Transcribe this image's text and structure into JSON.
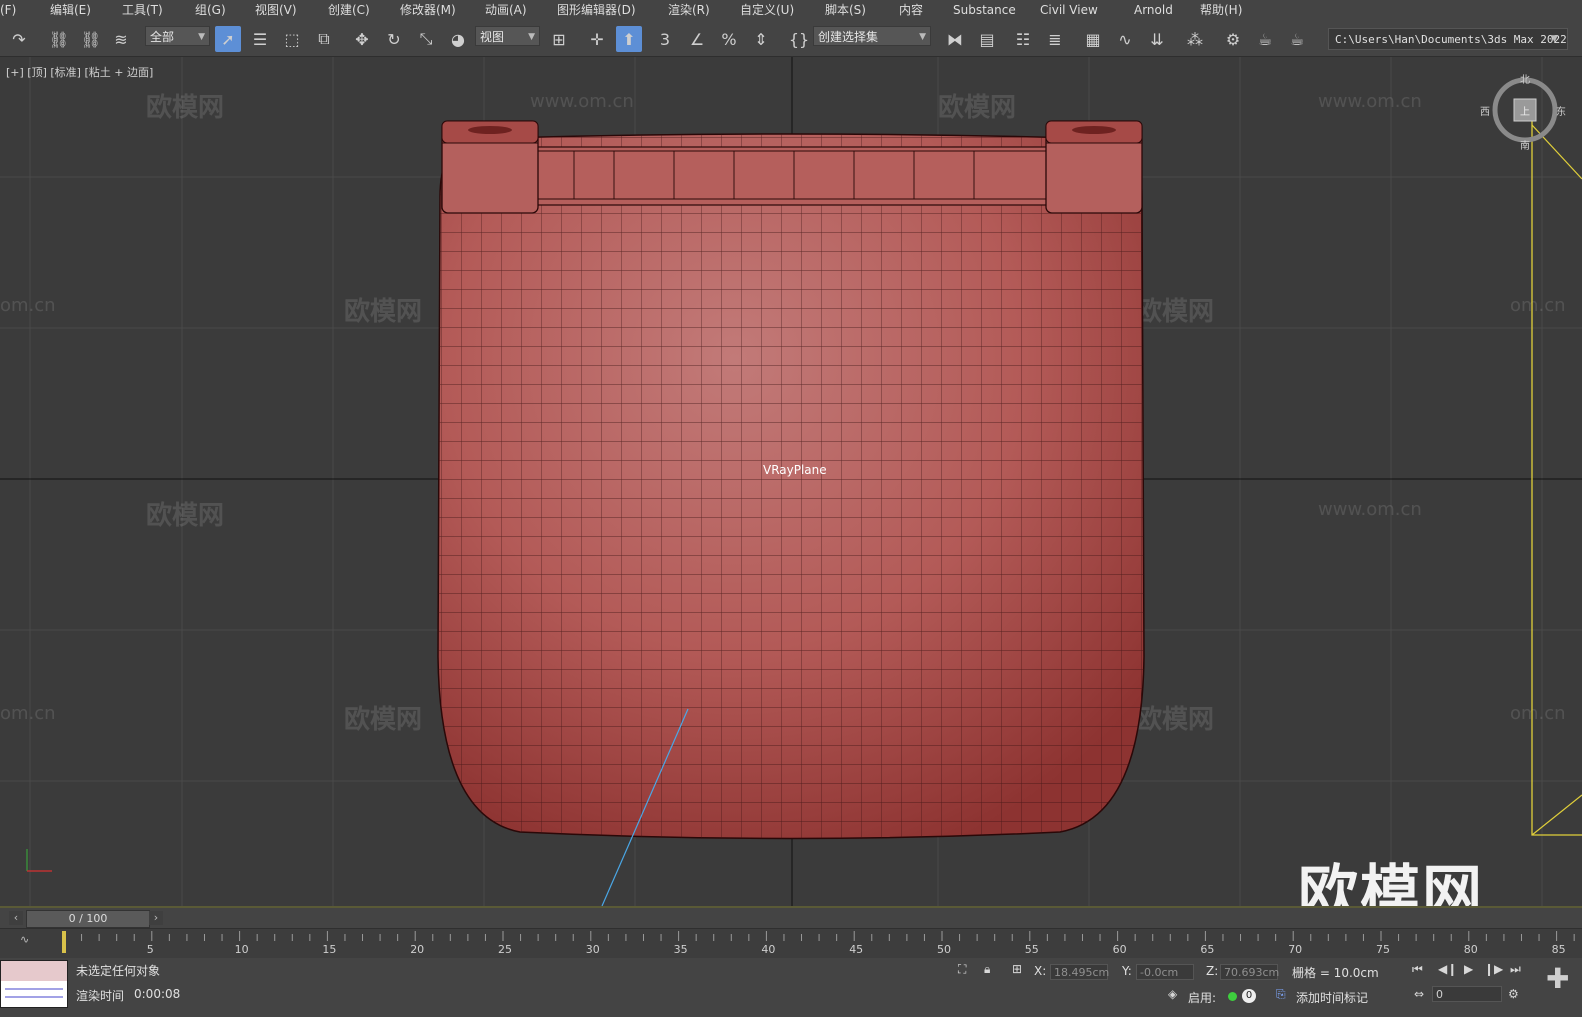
{
  "menu": [
    "(F)",
    "编辑(E)",
    "工具(T)",
    "组(G)",
    "视图(V)",
    "创建(C)",
    "修改器(M)",
    "动画(A)",
    "图形编辑器(D)",
    "渲染(R)",
    "自定义(U)",
    "脚本(S)",
    "内容",
    "Substance",
    "Civil View",
    "Arnold",
    "帮助(H)"
  ],
  "toolbar": {
    "selection_filter": "全部",
    "ref_coord": "视图",
    "named_selection": "创建选择集",
    "project_path": "C:\\Users\\Han\\Documents\\3ds Max 2022"
  },
  "viewport": {
    "label": "[+] [顶] [标准] [粘土 + 边面]",
    "object_name": "VRayPlane",
    "watermark_brand": "欧模网",
    "watermark_url": "www.om.cn",
    "watermark_url_short": "om.cn",
    "viewcube": {
      "top": "北",
      "left": "西",
      "right": "东",
      "bottom": "南",
      "face": "上"
    }
  },
  "timeline": {
    "frame_display": "0 / 100",
    "ticks": [
      "5",
      "10",
      "15",
      "20",
      "25",
      "30",
      "35",
      "40",
      "45",
      "50",
      "55",
      "60",
      "65",
      "70",
      "75",
      "80",
      "85"
    ]
  },
  "status": {
    "selection": "未选定任何对象",
    "render_time_label": "渲染时间",
    "render_time": "0:00:08",
    "x_label": "X:",
    "x_value": "18.495cm",
    "y_label": "Y:",
    "y_value": "-0.0cm",
    "z_label": "Z:",
    "z_value": "70.693cm",
    "grid": "栅格 = 10.0cm",
    "enable": "启用:",
    "add_time_tag": "添加时间标记",
    "frame_field": "0"
  },
  "colors": {
    "viewport_bg": "#3b3b3b",
    "model_fill": "#b35a57",
    "model_wire": "#3a1212",
    "accent_blue": "#5d8fd6",
    "selection_yellow": "#e0cf3a"
  }
}
